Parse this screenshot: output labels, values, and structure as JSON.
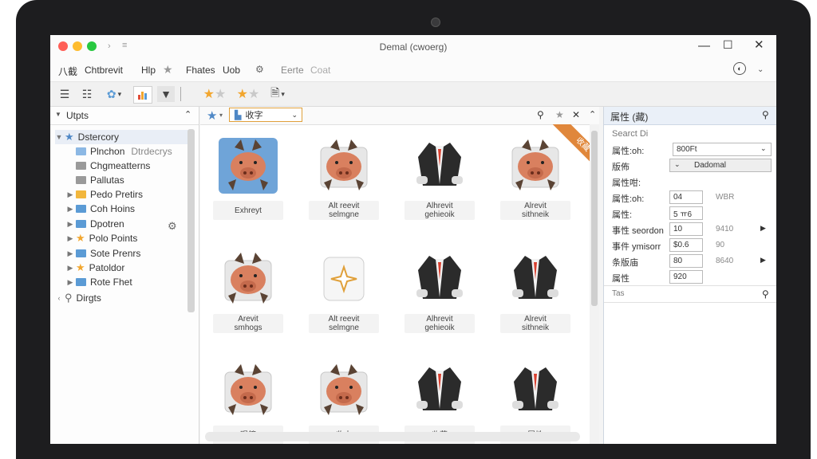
{
  "window": {
    "title": "Demal (cwoerg)"
  },
  "menu": [
    "八截",
    "Chtbrevit",
    "Hlp",
    "Fhates",
    "Uob",
    "Eerte",
    "Coat"
  ],
  "search_panel": {
    "dropdown_value": "收字"
  },
  "left_panel": {
    "header": "Utpts",
    "items": [
      {
        "label": "Dstercory",
        "icon": "star-icon",
        "color": "#4f88c6"
      },
      {
        "label": "Plnchon",
        "secondary": "Dtrdecrys",
        "icon": "folder-icon",
        "color": "#8cb8e4"
      },
      {
        "label": "Chgmeatterns",
        "icon": "folder-icon",
        "color": "#9a9a9a"
      },
      {
        "label": "Pallutas",
        "icon": "folder-icon",
        "color": "#9a9a9a"
      },
      {
        "label": "Pedo Pretirs",
        "icon": "folder-icon",
        "color": "#f2b73d"
      },
      {
        "label": "Coh Hoins",
        "icon": "folder-icon",
        "color": "#5b9bd5"
      },
      {
        "label": "Dpotren",
        "icon": "folder-icon",
        "color": "#5b9bd5"
      },
      {
        "label": "Polo Points",
        "icon": "star-icon",
        "color": "#f2a62e"
      },
      {
        "label": "Sote Prenrs",
        "icon": "folder-icon",
        "color": "#5b9bd5"
      },
      {
        "label": "Patoldor",
        "icon": "star-icon",
        "color": "#f2a62e"
      },
      {
        "label": "Rote Fhet",
        "icon": "folder-icon",
        "color": "#5b9bd5"
      },
      {
        "label": "Dirgts",
        "icon": "search-icon",
        "color": "#666666"
      }
    ]
  },
  "thumbnails": [
    {
      "kind": "pig",
      "line1": "Exhreyt",
      "line2": ""
    },
    {
      "kind": "pig",
      "line1": "Alt reevit",
      "line2": "selmgne"
    },
    {
      "kind": "jacket",
      "line1": "Alhrevit",
      "line2": "gehieoik"
    },
    {
      "kind": "pig",
      "line1": "Alrevit",
      "line2": "sithneik"
    },
    {
      "kind": "pig",
      "line1": "Arevit",
      "line2": "smhogs"
    },
    {
      "kind": "star",
      "line1": "Alt reevit",
      "line2": "selmgne"
    },
    {
      "kind": "jacket",
      "line1": "Alhrevit",
      "line2": "gehieoik"
    },
    {
      "kind": "jacket",
      "line1": "Alrevit",
      "line2": "sithneik"
    },
    {
      "kind": "pig",
      "line1": "眼鏑",
      "line2": ""
    },
    {
      "kind": "pig",
      "line1": "收本",
      "line2": ""
    },
    {
      "kind": "jacket",
      "line1": "收藏",
      "line2": ""
    },
    {
      "kind": "jacket",
      "line1": "属性",
      "line2": ""
    }
  ],
  "ribbon": {
    "text": "收藏"
  },
  "properties": {
    "header": "属性 (藏)",
    "search_label": "Searct Di",
    "rows": [
      {
        "label": "属性:oh:",
        "value": "800Ft",
        "extra": ""
      },
      {
        "label": "版佈",
        "value": "Dadomal",
        "extra": ""
      },
      {
        "label": "属性咁:",
        "value": "",
        "extra": ""
      },
      {
        "label": "属性:oh:",
        "value": "04",
        "extra": "WBR"
      },
      {
        "label": "属性:",
        "value": "5 ㅠ6",
        "extra": ""
      },
      {
        "label": "事性 seordon",
        "value": "10",
        "extra": "9410"
      },
      {
        "label": "事件 ymisorr",
        "value": "$0.6",
        "extra": "90"
      },
      {
        "label": "条版庙",
        "value": "80",
        "extra": "8640"
      },
      {
        "label": "属性",
        "value": "920",
        "extra": ""
      }
    ],
    "footer_label": "Tas"
  }
}
